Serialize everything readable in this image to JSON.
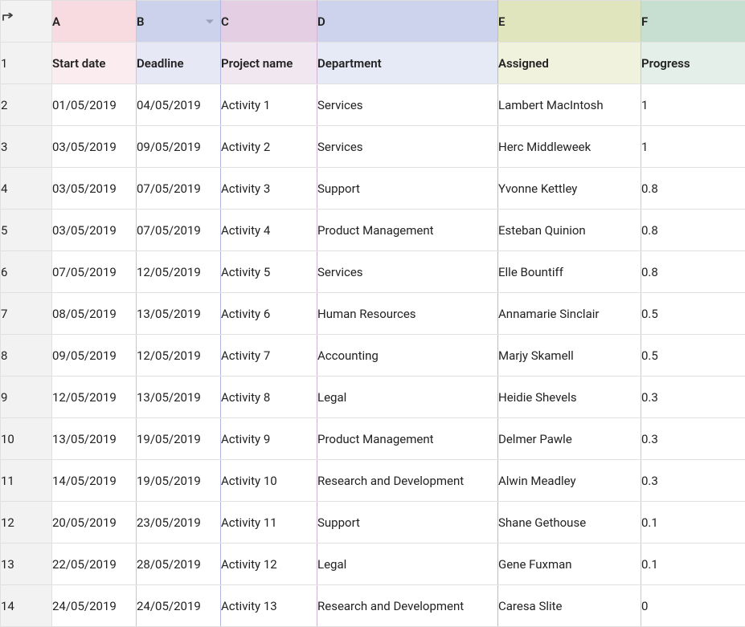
{
  "columns": [
    {
      "letter": "A",
      "header": "Start date"
    },
    {
      "letter": "B",
      "header": "Deadline"
    },
    {
      "letter": "C",
      "header": "Project name"
    },
    {
      "letter": "D",
      "header": "Department"
    },
    {
      "letter": "E",
      "header": "Assigned"
    },
    {
      "letter": "F",
      "header": "Progress"
    }
  ],
  "filter_column": "B",
  "row_numbers": [
    "1",
    "2",
    "3",
    "4",
    "5",
    "6",
    "7",
    "8",
    "9",
    "10",
    "11",
    "12",
    "13",
    "14"
  ],
  "rows": [
    {
      "A": "01/05/2019",
      "B": "04/05/2019",
      "C": "Activity 1",
      "D": "Services",
      "E": "Lambert MacIntosh",
      "F": "1"
    },
    {
      "A": "03/05/2019",
      "B": "09/05/2019",
      "C": "Activity 2",
      "D": "Services",
      "E": "Herc Middleweek",
      "F": "1"
    },
    {
      "A": "03/05/2019",
      "B": "07/05/2019",
      "C": "Activity 3",
      "D": "Support",
      "E": "Yvonne Kettley",
      "F": "0.8"
    },
    {
      "A": "03/05/2019",
      "B": "07/05/2019",
      "C": "Activity 4",
      "D": "Product Management",
      "E": "Esteban Quinion",
      "F": "0.8"
    },
    {
      "A": "07/05/2019",
      "B": "12/05/2019",
      "C": "Activity 5",
      "D": "Services",
      "E": "Elle Bountiff",
      "F": "0.8"
    },
    {
      "A": "08/05/2019",
      "B": "13/05/2019",
      "C": "Activity 6",
      "D": "Human Resources",
      "E": "Annamarie Sinclair",
      "F": "0.5"
    },
    {
      "A": "09/05/2019",
      "B": "12/05/2019",
      "C": "Activity 7",
      "D": "Accounting",
      "E": "Marjy Skamell",
      "F": "0.5"
    },
    {
      "A": "12/05/2019",
      "B": "13/05/2019",
      "C": "Activity 8",
      "D": "Legal",
      "E": "Heidie Shevels",
      "F": "0.3"
    },
    {
      "A": "13/05/2019",
      "B": "19/05/2019",
      "C": "Activity 9",
      "D": "Product Management",
      "E": "Delmer Pawle",
      "F": "0.3"
    },
    {
      "A": "14/05/2019",
      "B": "19/05/2019",
      "C": "Activity 10",
      "D": "Research and Development",
      "E": "Alwin Meadley",
      "F": "0.3"
    },
    {
      "A": "20/05/2019",
      "B": "23/05/2019",
      "C": "Activity 11",
      "D": "Support",
      "E": "Shane Gethouse",
      "F": "0.1"
    },
    {
      "A": "22/05/2019",
      "B": "28/05/2019",
      "C": "Activity 12",
      "D": "Legal",
      "E": "Gene Fuxman",
      "F": "0.1"
    },
    {
      "A": "24/05/2019",
      "B": "24/05/2019",
      "C": "Activity 13",
      "D": "Research and Development",
      "E": "Caresa Slite",
      "F": "0"
    }
  ]
}
